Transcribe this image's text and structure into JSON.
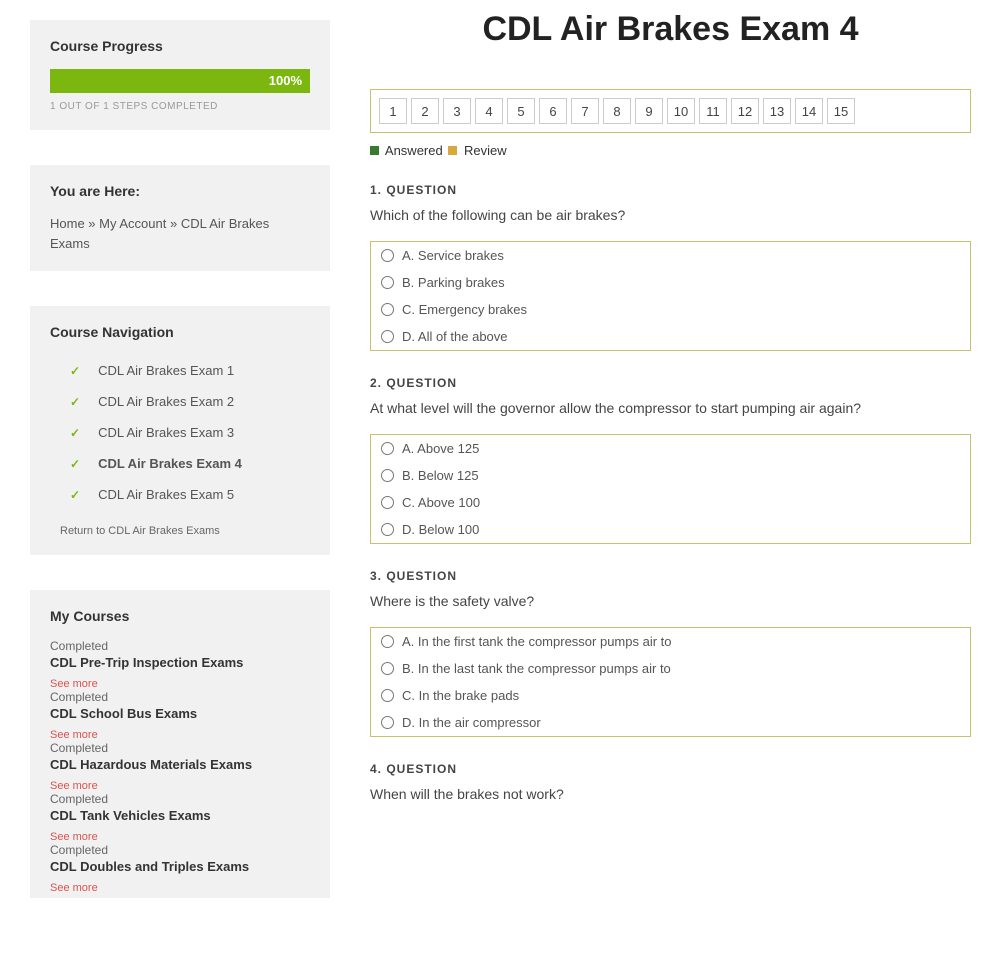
{
  "sidebar": {
    "progress": {
      "title": "Course Progress",
      "percent": "100%",
      "steps": "1 OUT OF 1 STEPS COMPLETED"
    },
    "location": {
      "title": "You are Here:",
      "crumb0": "Home",
      "sep0": " » ",
      "crumb1": "My Account",
      "sep1": " » ",
      "crumb2": "CDL Air Brakes Exams"
    },
    "nav": {
      "title": "Course Navigation",
      "items": [
        {
          "label": "CDL Air Brakes Exam 1",
          "active": false
        },
        {
          "label": "CDL Air Brakes Exam 2",
          "active": false
        },
        {
          "label": "CDL Air Brakes Exam 3",
          "active": false
        },
        {
          "label": "CDL Air Brakes Exam 4",
          "active": true
        },
        {
          "label": "CDL Air Brakes Exam 5",
          "active": false
        }
      ],
      "return": "Return to CDL Air Brakes Exams"
    },
    "mycourses": {
      "title": "My Courses",
      "see_more": "See more",
      "items": [
        {
          "status": "Completed",
          "name": "CDL Pre-Trip Inspection Exams"
        },
        {
          "status": "Completed",
          "name": "CDL School Bus Exams"
        },
        {
          "status": "Completed",
          "name": "CDL Hazardous Materials Exams"
        },
        {
          "status": "Completed",
          "name": "CDL Tank Vehicles Exams"
        },
        {
          "status": "Completed",
          "name": "CDL Doubles and Triples Exams"
        }
      ]
    }
  },
  "main": {
    "title": "CDL Air Brakes Exam 4",
    "qnav": [
      "1",
      "2",
      "3",
      "4",
      "5",
      "6",
      "7",
      "8",
      "9",
      "10",
      "11",
      "12",
      "13",
      "14",
      "15"
    ],
    "legend": {
      "answered": "Answered",
      "review": "Review"
    },
    "questions": [
      {
        "label": "1. QUESTION",
        "text": "Which of the following can be air brakes?",
        "options": [
          "A. Service brakes",
          "B. Parking brakes",
          "C. Emergency brakes",
          "D. All of the above"
        ]
      },
      {
        "label": "2. QUESTION",
        "text": "At what level will the governor allow the compressor to start pumping air again?",
        "options": [
          "A. Above 125",
          "B. Below 125",
          "C. Above 100",
          "D. Below 100"
        ]
      },
      {
        "label": "3. QUESTION",
        "text": "Where is the safety valve?",
        "options": [
          "A. In the first tank the compressor pumps air to",
          "B. In the last tank the compressor pumps air to",
          "C. In the brake pads",
          "D. In the air compressor"
        ]
      },
      {
        "label": "4. QUESTION",
        "text": "When will the brakes not work?",
        "options": []
      }
    ]
  }
}
